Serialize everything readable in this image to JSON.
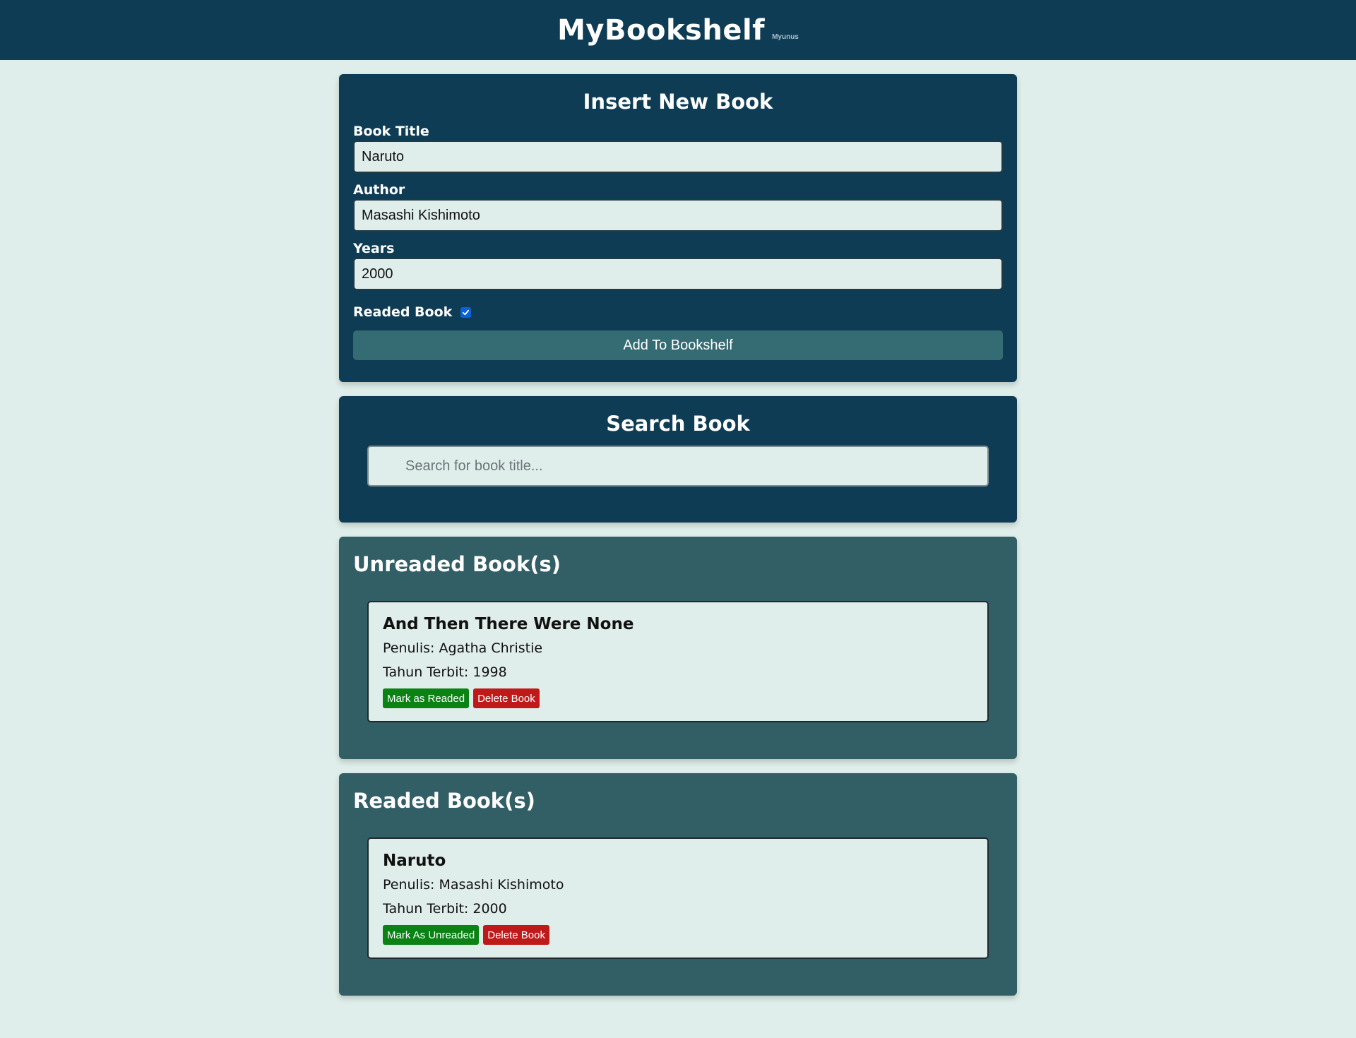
{
  "header": {
    "title": "MyBookshelf",
    "subtitle": "Myunus"
  },
  "insert_form": {
    "heading": "Insert New Book",
    "title_label": "Book Title",
    "title_value": "Naruto",
    "author_label": "Author",
    "author_value": "Masashi Kishimoto",
    "year_label": "Years",
    "year_value": "2000",
    "readed_label": "Readed Book",
    "readed_checked": true,
    "submit_label": "Add To Bookshelf"
  },
  "search": {
    "heading": "Search Book",
    "placeholder": "Search for book title...",
    "value": ""
  },
  "unreaded": {
    "heading": "Unreaded Book(s)",
    "books": [
      {
        "title": "And Then There Were None",
        "author_line": "Penulis: Agatha Christie",
        "year_line": "Tahun Terbit: 1998",
        "toggle_label": "Mark as Readed",
        "delete_label": "Delete Book"
      }
    ]
  },
  "readed": {
    "heading": "Readed Book(s)",
    "books": [
      {
        "title": "Naruto",
        "author_line": "Penulis: Masashi Kishimoto",
        "year_line": "Tahun Terbit: 2000",
        "toggle_label": "Mark As Unreaded",
        "delete_label": "Delete Book"
      }
    ]
  },
  "colors": {
    "header_bg": "#0e3c55",
    "page_bg": "#dfeeea",
    "shelf_bg": "#325e66",
    "button_bg": "#356b72",
    "green": "#0a8214",
    "red": "#bf1a1a",
    "checkbox": "#0b62d6"
  },
  "icons": {
    "search": "search-icon",
    "check": "check-icon"
  }
}
